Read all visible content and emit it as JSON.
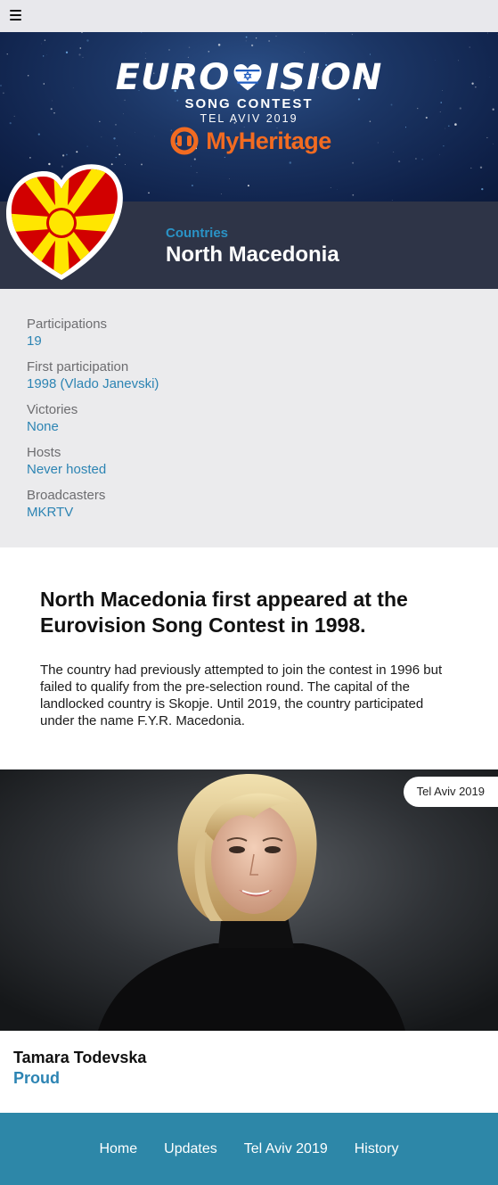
{
  "header": {
    "menu_icon": "hamburger-menu-icon"
  },
  "hero": {
    "logo_word": "EUROVISION",
    "logo_left": "EURO",
    "logo_right": "ISION",
    "logo_subtitle": "SONG CONTEST",
    "logo_city": "TEL AVIV 2019",
    "sponsor": "MyHeritage",
    "colors": {
      "background": "#1b3564",
      "sponsor": "#f26b21"
    }
  },
  "country": {
    "breadcrumb": "Countries",
    "name": "North Macedonia",
    "flag_icon": "north-macedonia-heart-flag-icon",
    "colors": {
      "band": "#2e3447",
      "flag_red": "#d20000",
      "flag_yellow": "#ffe600"
    }
  },
  "facts": [
    {
      "label": "Participations",
      "value": "19"
    },
    {
      "label": "First participation",
      "value": "1998 (Vlado Janevski)"
    },
    {
      "label": "Victories",
      "value": "None"
    },
    {
      "label": "Hosts",
      "value": "Never hosted"
    },
    {
      "label": "Broadcasters",
      "value": "MKRTV"
    }
  ],
  "intro": {
    "heading": "North Macedonia first appeared at the Eurovision Song Contest in 1998.",
    "body": "The country had previously attempted to join the contest in 1996 but failed to qualify from the pre-selection round. The capital of the landlocked country is Skopje. Until 2019, the country participated under the name F.Y.R. Macedonia."
  },
  "entry": {
    "edition_badge": "Tel Aviv 2019",
    "artist": "Tamara Todevska",
    "song": "Proud"
  },
  "footer": {
    "links": [
      "Home",
      "Updates",
      "Tel Aviv 2019",
      "History"
    ],
    "color": "#2d87a8"
  }
}
